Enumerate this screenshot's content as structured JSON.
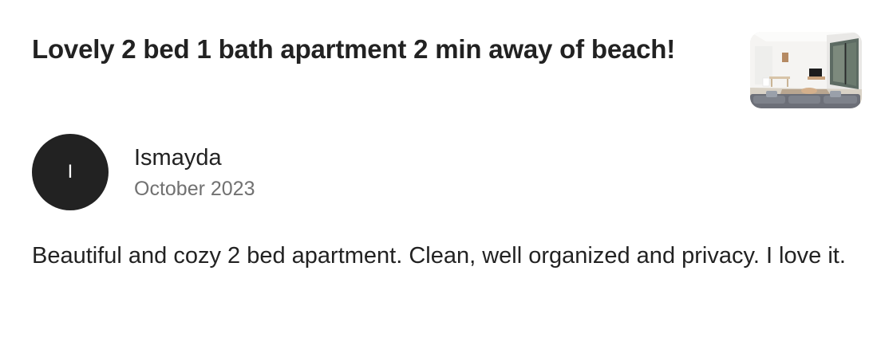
{
  "listing": {
    "title": "Lovely 2 bed 1 bath apartment 2 min away of beach!",
    "thumbnail_alt": "Listing photo"
  },
  "review": {
    "avatar_initial": "I",
    "reviewer_name": "Ismayda",
    "date": "October 2023",
    "text": "Beautiful and cozy 2 bed apartment. Clean, well organized and privacy. I love it."
  },
  "colors": {
    "text_primary": "#222222",
    "text_secondary": "#717171",
    "avatar_bg": "#222222",
    "avatar_text": "#ffffff"
  }
}
